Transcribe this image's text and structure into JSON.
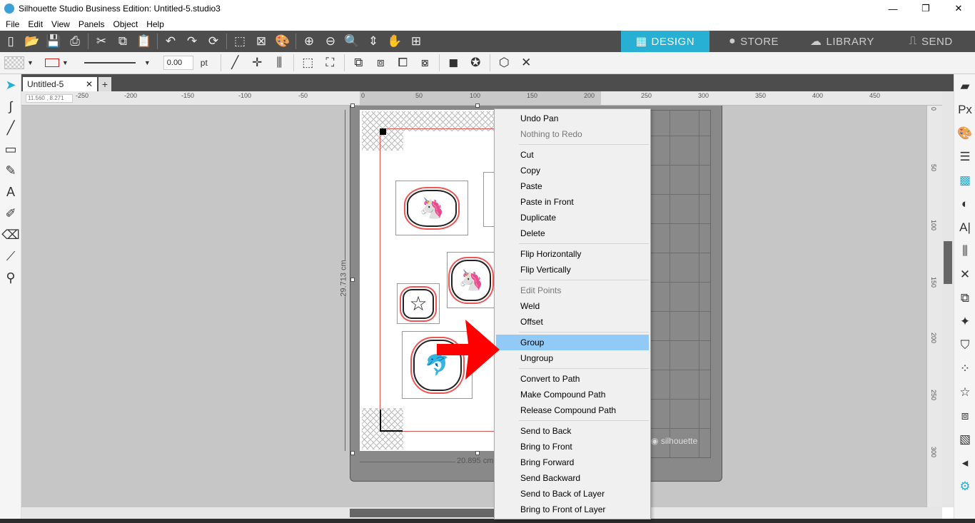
{
  "window": {
    "title": "Silhouette Studio Business Edition: Untitled-5.studio3",
    "controls": [
      "—",
      "❐",
      "✕"
    ]
  },
  "menu": [
    "File",
    "Edit",
    "View",
    "Panels",
    "Object",
    "Help"
  ],
  "nav_tabs": [
    {
      "label": "DESIGN",
      "icon": "grid-icon"
    },
    {
      "label": "STORE",
      "icon": "store-icon"
    },
    {
      "label": "LIBRARY",
      "icon": "cloud-library-icon"
    },
    {
      "label": "SEND",
      "icon": "cutter-send-icon"
    }
  ],
  "toolbar2": {
    "line_width": "0.00",
    "line_unit": "pt"
  },
  "document_tab": {
    "name": "Untitled-5",
    "close": "✕",
    "add": "+"
  },
  "coords": "11.560 , 8.271",
  "ruler_top_labels": [
    "-250",
    "-200",
    "-150",
    "-100",
    "-50",
    "0",
    "50",
    "100",
    "150",
    "200",
    "250",
    "300",
    "350",
    "400",
    "450"
  ],
  "ruler_right_labels": [
    "0",
    "50",
    "100",
    "150",
    "200",
    "250",
    "300"
  ],
  "dimensions": {
    "height": "29.713 cm",
    "width": "20.895 cm"
  },
  "mat_brand": "silhouette",
  "context_menu": {
    "groups": [
      [
        {
          "label": "Undo Pan",
          "enabled": true
        },
        {
          "label": "Nothing to Redo",
          "enabled": false
        }
      ],
      [
        {
          "label": "Cut",
          "enabled": true
        },
        {
          "label": "Copy",
          "enabled": true
        },
        {
          "label": "Paste",
          "enabled": true
        },
        {
          "label": "Paste in Front",
          "enabled": true
        },
        {
          "label": "Duplicate",
          "enabled": true
        },
        {
          "label": "Delete",
          "enabled": true
        }
      ],
      [
        {
          "label": "Flip Horizontally",
          "enabled": true
        },
        {
          "label": "Flip Vertically",
          "enabled": true
        }
      ],
      [
        {
          "label": "Edit Points",
          "enabled": false
        },
        {
          "label": "Weld",
          "enabled": true
        },
        {
          "label": "Offset",
          "enabled": true
        }
      ],
      [
        {
          "label": "Group",
          "enabled": true,
          "highlighted": true
        },
        {
          "label": "Ungroup",
          "enabled": true
        }
      ],
      [
        {
          "label": "Convert to Path",
          "enabled": true
        },
        {
          "label": "Make Compound Path",
          "enabled": true
        },
        {
          "label": "Release Compound Path",
          "enabled": true
        }
      ],
      [
        {
          "label": "Send to Back",
          "enabled": true
        },
        {
          "label": "Bring to Front",
          "enabled": true
        },
        {
          "label": "Bring Forward",
          "enabled": true
        },
        {
          "label": "Send Backward",
          "enabled": true
        },
        {
          "label": "Send to Back of Layer",
          "enabled": true
        },
        {
          "label": "Bring to Front of Layer",
          "enabled": true
        }
      ]
    ]
  },
  "colors": {
    "accent": "#28b0d4",
    "toolbar": "#4d4d4d",
    "menu_highlight": "#91c9f7",
    "annotation_arrow": "#ff0000"
  }
}
